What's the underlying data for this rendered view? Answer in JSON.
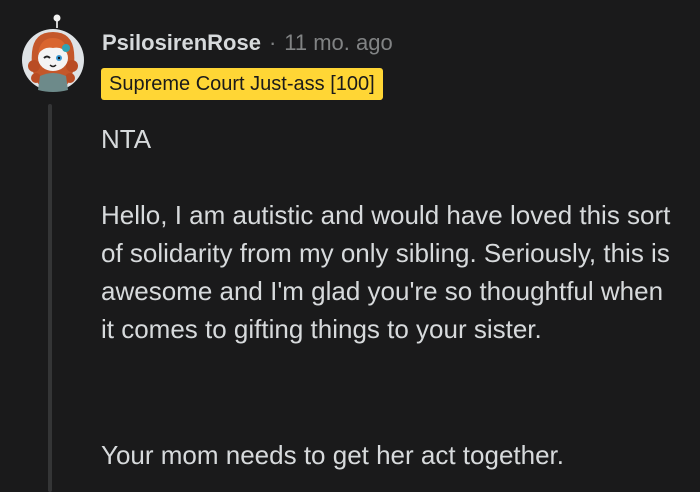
{
  "comment": {
    "author": "PsilosirenRose",
    "separator": "·",
    "timestamp": "11 mo. ago",
    "flair": "Supreme Court Just-ass [100]",
    "paragraphs": [
      "NTA",
      "Hello, I am autistic and would have loved this sort of solidarity from my only sibling. Seriously, this is awesome and I'm glad you're so thoughtful when it comes to gifting things to your sister.",
      "Your mom needs to get her act together."
    ]
  },
  "colors": {
    "background": "#1a1a1b",
    "text": "#d7dadc",
    "meta": "#818384",
    "flair_background": "#ffd635",
    "flair_text": "#1a1a1b",
    "thread_line": "#343536"
  },
  "icons": {
    "avatar": "snoo-avatar-icon"
  }
}
